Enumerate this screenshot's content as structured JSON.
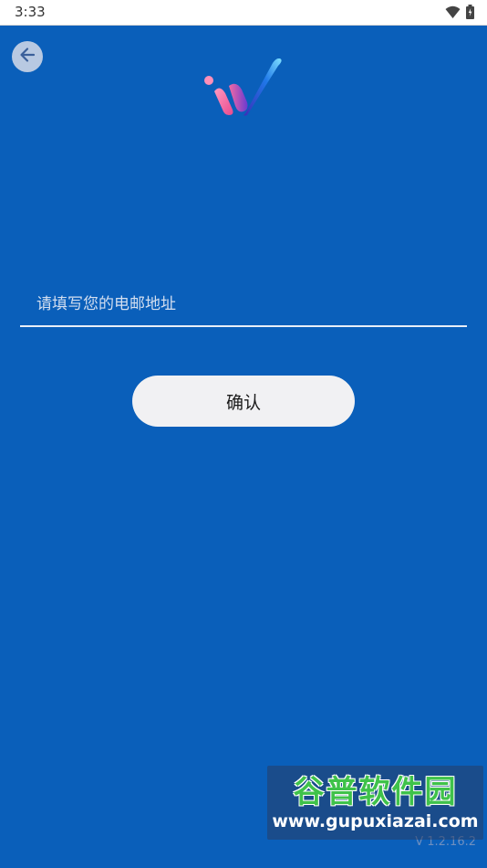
{
  "status_bar": {
    "time": "3:33",
    "icons": [
      "wifi-icon",
      "battery-icon"
    ]
  },
  "header": {
    "back_icon": "arrow-left-icon",
    "logo": "app-logo"
  },
  "form": {
    "email_placeholder": "请填写您的电邮地址",
    "email_value": "",
    "confirm_label": "确认"
  },
  "footer": {
    "version": "V 1.2.16.2"
  },
  "watermark": {
    "title": "谷普软件园",
    "url": "www.gupuxiazai.com"
  },
  "colors": {
    "background": "#0a5fba",
    "button": "#f1f1f3",
    "underline": "#e8eef8"
  }
}
